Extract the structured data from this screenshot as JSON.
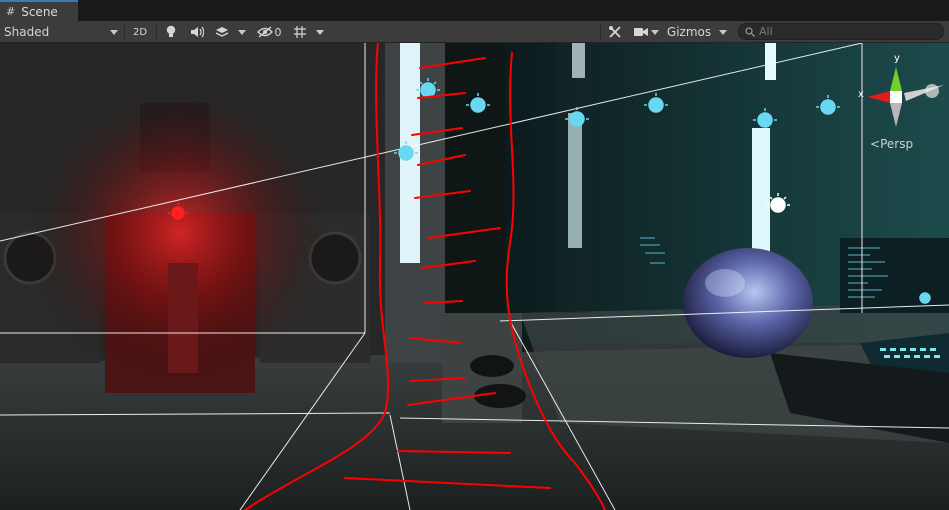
{
  "tab": {
    "label": "Scene",
    "icon": "grid-icon"
  },
  "toolbar": {
    "draw_mode": "Shaded",
    "mode_2d": "2D",
    "hidden_count": "0",
    "gizmos_label": "Gizmos",
    "search_placeholder": "All"
  },
  "gizmo": {
    "x_label": "x",
    "y_label": "y",
    "projection": "Persp"
  },
  "colors": {
    "tab_accent": "#3a79bb",
    "annotation_red": "#ff0000",
    "light_icon": "#6ad8f0",
    "gizmo_x": "#e01c1c",
    "gizmo_y": "#6fd12a"
  }
}
